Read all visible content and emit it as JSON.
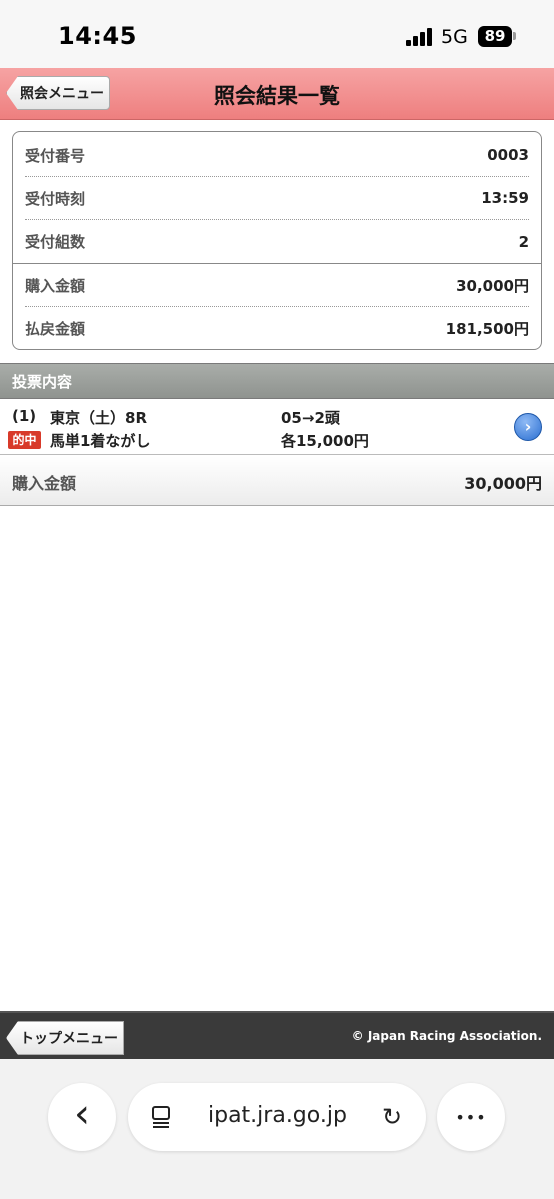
{
  "status": {
    "time": "14:45",
    "network": "5G",
    "battery": "89"
  },
  "header": {
    "back_label": "照会メニュー",
    "title": "照会結果一覧"
  },
  "info": {
    "rows": [
      {
        "label": "受付番号",
        "value": "0003"
      },
      {
        "label": "受付時刻",
        "value": "13:59"
      },
      {
        "label": "受付組数",
        "value": "2"
      },
      {
        "label": "購入金額",
        "value": "30,000円"
      },
      {
        "label": "払戻金額",
        "value": "181,500円"
      }
    ]
  },
  "section": {
    "title": "投票内容"
  },
  "bet": {
    "number": "(1)",
    "venue": "東京（土）8R",
    "combination": "05→2頭",
    "hit_badge": "的中",
    "bet_type": "馬単1着ながし",
    "amount": "各15,000円",
    "arrow": "›"
  },
  "total": {
    "label": "購入金額",
    "value": "30,000円"
  },
  "footer": {
    "top_menu_label": "トップメニュー",
    "copyright": "© Japan Racing Association."
  },
  "browser": {
    "url": "ipat.jra.go.jp",
    "back_glyph": "‹",
    "more_glyph": "•••",
    "reload_glyph": "↻"
  }
}
